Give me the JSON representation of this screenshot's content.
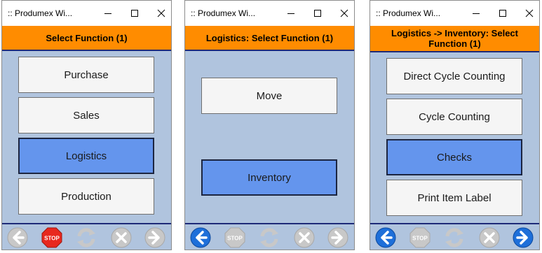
{
  "windows": [
    {
      "title": ":: Produmex Wi...",
      "header": "Select Function (1)",
      "buttons": [
        {
          "label": "Purchase",
          "selected": false
        },
        {
          "label": "Sales",
          "selected": false
        },
        {
          "label": "Logistics",
          "selected": true
        },
        {
          "label": "Production",
          "selected": false
        }
      ],
      "footer": {
        "back": "disabled",
        "stop": "enabled",
        "refresh": "disabled",
        "cancel": "disabled",
        "next": "disabled"
      }
    },
    {
      "title": ":: Produmex Wi...",
      "header": "Logistics: Select Function (1)",
      "buttons": [
        {
          "label": "Move",
          "selected": false
        },
        {
          "label": "Inventory",
          "selected": true
        }
      ],
      "footer": {
        "back": "enabled",
        "stop": "disabled",
        "refresh": "disabled",
        "cancel": "disabled",
        "next": "disabled"
      }
    },
    {
      "title": ":: Produmex Wi...",
      "header": "Logistics -> Inventory: Select Function (1)",
      "buttons": [
        {
          "label": "Direct Cycle Counting",
          "selected": false
        },
        {
          "label": "Cycle Counting",
          "selected": false
        },
        {
          "label": "Checks",
          "selected": true
        },
        {
          "label": "Print Item Label",
          "selected": false
        }
      ],
      "footer": {
        "back": "enabled",
        "stop": "disabled",
        "refresh": "disabled",
        "cancel": "disabled",
        "next": "enabled"
      }
    }
  ],
  "icons": {
    "titlebar": [
      "minimize-icon",
      "maximize-icon",
      "close-icon"
    ],
    "footer": [
      "back-arrow-icon",
      "stop-icon",
      "refresh-icon",
      "cancel-icon",
      "next-arrow-icon"
    ],
    "stop_text": "STOP"
  },
  "colors": {
    "background": "#b0c4de",
    "header": "#ff8c00",
    "selected_button": "#6495ed",
    "button": "#f5f5f5",
    "nav_enabled": "#1e6fd9",
    "stop_enabled": "#e8281e",
    "disabled": "#c8c8c8"
  }
}
